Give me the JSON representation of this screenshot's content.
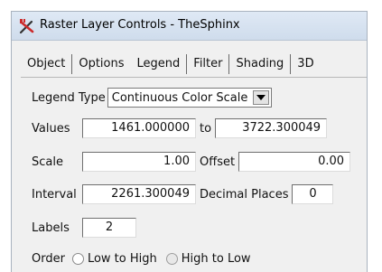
{
  "window": {
    "title": "Raster Layer Controls - TheSphinx"
  },
  "tabs": [
    {
      "label": "Object"
    },
    {
      "label": "Options"
    },
    {
      "label": "Legend"
    },
    {
      "label": "Filter"
    },
    {
      "label": "Shading"
    },
    {
      "label": "3D"
    }
  ],
  "legend": {
    "legend_type_label": "Legend Type",
    "legend_type_value": "Continuous Color Scale",
    "values_label": "Values",
    "values_from": "1461.000000",
    "to_label": "to",
    "values_to": "3722.300049",
    "scale_label": "Scale",
    "scale_value": "1.00",
    "offset_label": "Offset",
    "offset_value": "0.00",
    "interval_label": "Interval",
    "interval_value": "2261.300049",
    "decimal_places_label": "Decimal Places",
    "decimal_places_value": "0",
    "labels_label": "Labels",
    "labels_value": "2",
    "order_label": "Order",
    "order_low_to_high": "Low to High",
    "order_high_to_low": "High to Low",
    "order_selected": "Low to High"
  },
  "colors": {
    "titlebar": "#dfe9f5",
    "window_bg": "#f0f0f0",
    "app_icon_red": "#cc2b2b",
    "app_icon_dark": "#333333"
  },
  "icons": [
    "app-icon"
  ]
}
